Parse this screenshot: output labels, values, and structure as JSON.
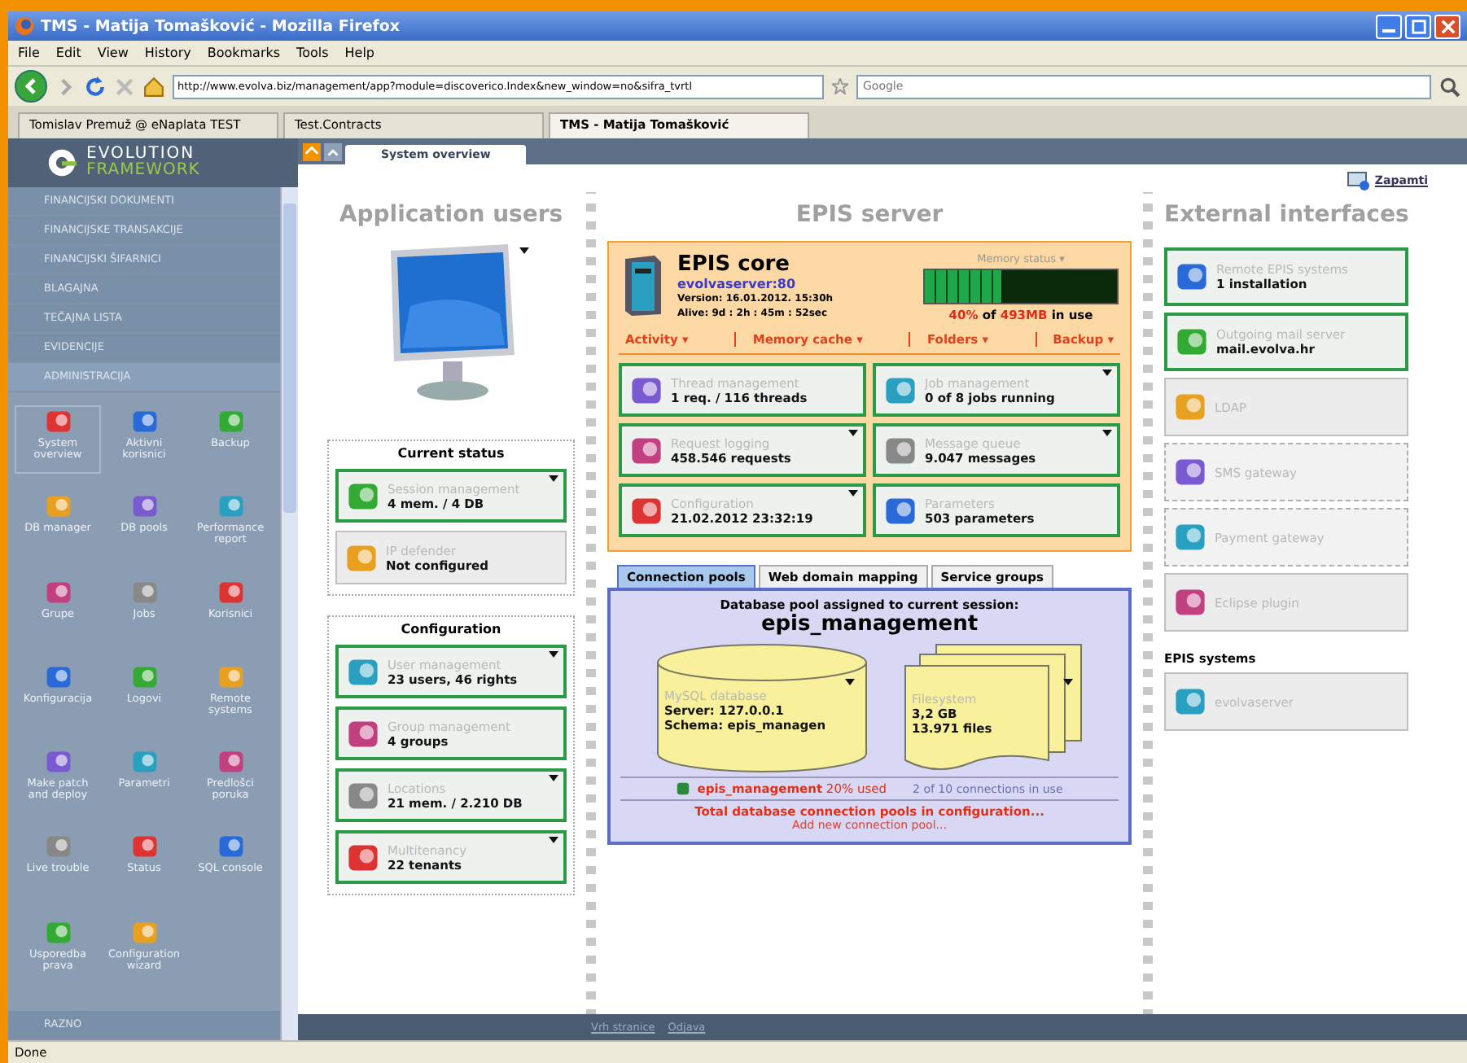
{
  "window": {
    "title": "TMS - Matija Tomašković - Mozilla Firefox"
  },
  "menu": [
    "File",
    "Edit",
    "View",
    "History",
    "Bookmarks",
    "Tools",
    "Help"
  ],
  "address": {
    "value": "http://www.evolva.biz/management/app?module=discoverico.Index&new_window=no&sifra_tvrtl"
  },
  "search": {
    "placeholder": "Google"
  },
  "browser_tabs": [
    {
      "label": "Tomislav Premuž @ eNaplata TEST",
      "selected": false
    },
    {
      "label": "Test.Contracts",
      "selected": false
    },
    {
      "label": "TMS - Matija Tomašković",
      "selected": true
    }
  ],
  "sidebar": {
    "logo": [
      "EVOLUTION",
      "FRAMEWORK"
    ],
    "sections": [
      {
        "label": "FINANCIJSKI DOKUMENTI",
        "selected": false
      },
      {
        "label": "FINANCIJSKE TRANSAKCIJE",
        "selected": false
      },
      {
        "label": "FINANCIJSKI ŠIFARNICI",
        "selected": false
      },
      {
        "label": "BLAGAJNA",
        "selected": false
      },
      {
        "label": "TEČAJNA LISTA",
        "selected": false
      },
      {
        "label": "EVIDENCIJE",
        "selected": false
      },
      {
        "label": "ADMINISTRACIJA",
        "selected": true
      }
    ],
    "items": [
      {
        "label": "System overview",
        "selected": true
      },
      {
        "label": "Aktivni korisnici",
        "selected": false
      },
      {
        "label": "Backup",
        "selected": false
      },
      {
        "label": "DB manager",
        "selected": false
      },
      {
        "label": "DB pools",
        "selected": false
      },
      {
        "label": "Performance report",
        "selected": false
      },
      {
        "label": "Grupe",
        "selected": false
      },
      {
        "label": "Jobs",
        "selected": false
      },
      {
        "label": "Korisnici",
        "selected": false
      },
      {
        "label": "Konfiguracija",
        "selected": false
      },
      {
        "label": "Logovi",
        "selected": false
      },
      {
        "label": "Remote systems",
        "selected": false
      },
      {
        "label": "Make patch and deploy",
        "selected": false
      },
      {
        "label": "Parametri",
        "selected": false
      },
      {
        "label": "Predlošci poruka",
        "selected": false
      },
      {
        "label": "Live trouble",
        "selected": false
      },
      {
        "label": "Status",
        "selected": false
      },
      {
        "label": "SQL console",
        "selected": false
      },
      {
        "label": "Usporedba prava",
        "selected": false
      },
      {
        "label": "Configuration wizard",
        "selected": false
      }
    ],
    "footer_section": "RAZNO"
  },
  "page_tabs": [
    {
      "label": "System overview",
      "selected": true
    }
  ],
  "save_link": "Zapamti",
  "app_users": {
    "title": "Application users",
    "groups": [
      {
        "title": "Current status",
        "cards": [
          {
            "kind": "active",
            "title": "Session management",
            "value": "4 mem. / 4 DB",
            "menu": true
          },
          {
            "kind": "inactive",
            "title": "IP defender",
            "value": "Not configured",
            "menu": false
          }
        ]
      },
      {
        "title": "Configuration",
        "cards": [
          {
            "kind": "active",
            "title": "User management",
            "value": "23 users, 46 rights",
            "menu": true
          },
          {
            "kind": "active",
            "title": "Group management",
            "value": "4 groups",
            "menu": false
          },
          {
            "kind": "active",
            "title": "Locations",
            "value": "21 mem. / 2.210 DB",
            "menu": true
          },
          {
            "kind": "active",
            "title": "Multitenancy",
            "value": "22 tenants",
            "menu": true
          }
        ]
      }
    ]
  },
  "epis": {
    "title": "EPIS server",
    "core": {
      "name": "EPIS core",
      "host": "evolvaserver:80",
      "version": "Version: 16.01.2012. 15:30h",
      "alive": "Alive: 9d : 2h : 45m : 52sec",
      "memory": {
        "label": "Memory status ▾",
        "level": 0.4,
        "percent": "40%",
        "of": "of",
        "total": "493MB",
        "suffix": "in use"
      },
      "actions": [
        "Activity ▾",
        "Memory cache ▾",
        "Folders ▾",
        "Backup ▾"
      ],
      "cards": [
        {
          "kind": "active",
          "title": "Thread management",
          "value": "1 req. / 116 threads",
          "menu": false
        },
        {
          "kind": "active",
          "title": "Job management",
          "value": "0 of 8 jobs running",
          "menu": true
        },
        {
          "kind": "active",
          "title": "Request logging",
          "value": "458.546 requests",
          "menu": true
        },
        {
          "kind": "active",
          "title": "Message queue",
          "value": "9.047 messages",
          "menu": true
        },
        {
          "kind": "active",
          "title": "Configuration",
          "value": "21.02.2012 23:32:19",
          "menu": true
        },
        {
          "kind": "active",
          "title": "Parameters",
          "value": "503 parameters",
          "menu": false
        }
      ]
    },
    "tabs": [
      {
        "label": "Connection pools",
        "selected": true
      },
      {
        "label": "Web domain mapping",
        "selected": false
      },
      {
        "label": "Service groups",
        "selected": false
      }
    ],
    "pool": {
      "caption": "Database pool assigned to current session:",
      "name": "epis_management",
      "database": {
        "title": "MySQL database",
        "lines": [
          "Server: 127.0.0.1",
          "Schema: epis_managen"
        ],
        "menu": true
      },
      "filesystem": {
        "title": "Filesystem",
        "lines": [
          "3,2 GB",
          "13.971 files"
        ],
        "menu": true
      },
      "usage": {
        "name": "epis_management",
        "used": "20% used",
        "connections": "2 of 10 connections in use"
      },
      "total_link": "Total database connection pools in configuration...",
      "add_link": "Add new connection pool..."
    }
  },
  "external": {
    "title": "External interfaces",
    "cards": [
      {
        "kind": "active",
        "title": "Remote EPIS systems",
        "value": "1 installation"
      },
      {
        "kind": "active",
        "title": "Outgoing mail server",
        "value": "mail.evolva.hr"
      },
      {
        "kind": "inactive",
        "title": "LDAP"
      },
      {
        "kind": "dashed",
        "title": "SMS gateway"
      },
      {
        "kind": "dashed",
        "title": "Payment gateway"
      },
      {
        "kind": "inactive",
        "title": "Eclipse plugin"
      }
    ],
    "systems_title": "EPIS systems",
    "systems": [
      {
        "kind": "inactive",
        "title": "evolvaserver"
      }
    ]
  },
  "footer_links": [
    "Vrh stranice",
    "Odjava"
  ],
  "status_bar": "Done"
}
